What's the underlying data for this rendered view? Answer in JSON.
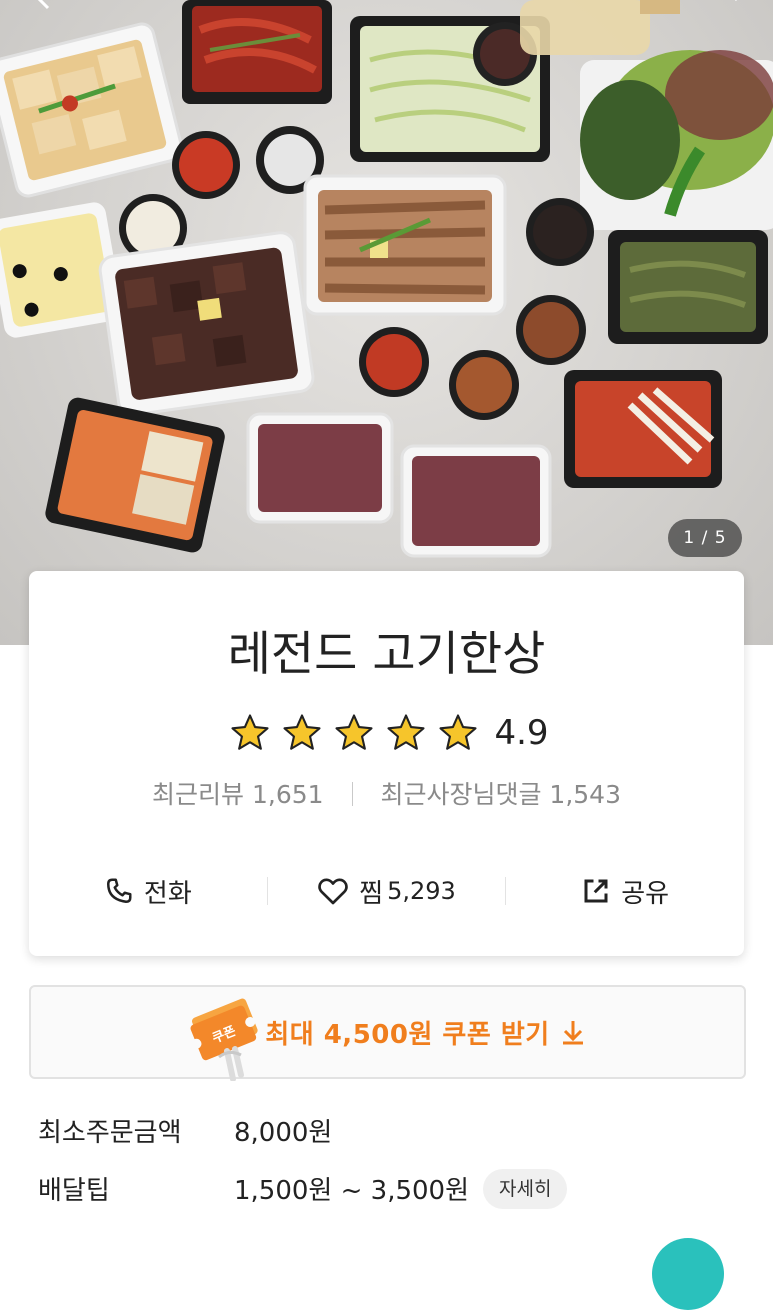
{
  "hero": {
    "counter": "1 / 5",
    "icons": [
      "back-arrow-icon",
      "search-icon"
    ]
  },
  "store": {
    "name": "레전드 고기한상",
    "rating": 4.9,
    "rating_text": "4.9",
    "stars_filled": 5,
    "stars_total": 5,
    "recent_reviews_label": "최근리뷰",
    "recent_reviews_count": "1,651",
    "owner_replies_label": "최근사장님댓글",
    "owner_replies_count": "1,543"
  },
  "actions": {
    "call_label": "전화",
    "like_label": "찜",
    "like_count": "5,293",
    "share_label": "공유"
  },
  "coupon": {
    "badge_text": "쿠폰",
    "label": "최대 4,500원 쿠폰 받기"
  },
  "delivery": {
    "min_order_label": "최소주문금액",
    "min_order_value": "8,000원",
    "tip_label": "배달팁",
    "tip_value": "1,500원 ~ 3,500원",
    "detail_button": "자세히"
  },
  "colors": {
    "accent": "#f07e1d",
    "star": "#f6c52b",
    "fab": "#2ac1bc"
  }
}
